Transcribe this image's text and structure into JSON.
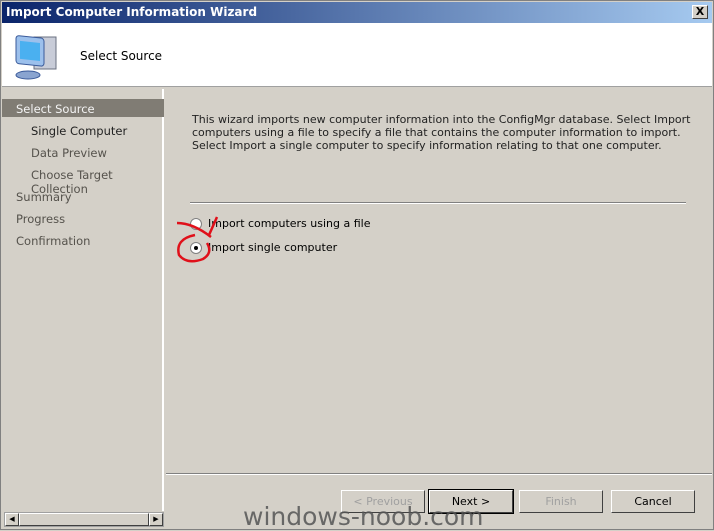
{
  "window": {
    "title": "Import Computer Information Wizard",
    "close_label": "X"
  },
  "header": {
    "title": "Select Source",
    "icon": "computer-icon"
  },
  "nav": {
    "items": [
      {
        "label": "Select Source",
        "selected": true
      },
      {
        "label": "Single Computer"
      },
      {
        "label": "Data Preview"
      },
      {
        "label": "Choose Target Collection"
      },
      {
        "label": "Summary"
      },
      {
        "label": "Progress"
      },
      {
        "label": "Confirmation"
      }
    ]
  },
  "main": {
    "description": "This wizard imports new computer information into the ConfigMgr database. Select Import computers using a file to specify a file that contains the computer information to import. Select Import a single computer to specify information relating to that one computer.",
    "options": [
      {
        "label": "Import computers using a file",
        "checked": false
      },
      {
        "label": "Import single computer",
        "checked": true
      }
    ],
    "annotation_color": "#e0101a"
  },
  "buttons": {
    "previous": "< Previous",
    "next": "Next >",
    "finish": "Finish",
    "cancel": "Cancel"
  },
  "watermark": "windows-noob.com"
}
